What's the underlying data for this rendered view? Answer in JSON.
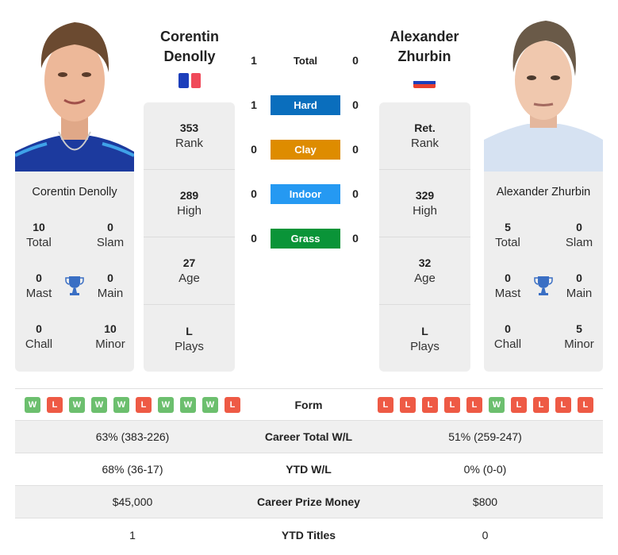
{
  "player1": {
    "name": "Corentin Denolly",
    "name_line1": "Corentin",
    "name_line2": "Denolly",
    "country_flag": "France",
    "flag_colors": [
      "#1d3fbb",
      "#ffffff",
      "#f04a5a"
    ],
    "stats": [
      {
        "value": "353",
        "label": "Rank"
      },
      {
        "value": "289",
        "label": "High"
      },
      {
        "value": "27",
        "label": "Age"
      },
      {
        "value": "L",
        "label": "Plays"
      }
    ],
    "titles": {
      "total": {
        "value": "10",
        "label": "Total"
      },
      "slam": {
        "value": "0",
        "label": "Slam"
      },
      "mast": {
        "value": "0",
        "label": "Mast"
      },
      "main": {
        "value": "0",
        "label": "Main"
      },
      "chall": {
        "value": "0",
        "label": "Chall"
      },
      "minor": {
        "value": "10",
        "label": "Minor"
      }
    },
    "form": [
      "W",
      "L",
      "W",
      "W",
      "W",
      "L",
      "W",
      "W",
      "W",
      "L"
    ]
  },
  "player2": {
    "name": "Alexander Zhurbin",
    "name_line1": "Alexander",
    "name_line2": "Zhurbin",
    "country_flag": "Russia",
    "flag_colors": [
      "#ffffff",
      "#1c3fbb",
      "#e8402e"
    ],
    "stats": [
      {
        "value": "Ret.",
        "label": "Rank"
      },
      {
        "value": "329",
        "label": "High"
      },
      {
        "value": "32",
        "label": "Age"
      },
      {
        "value": "L",
        "label": "Plays"
      }
    ],
    "titles": {
      "total": {
        "value": "5",
        "label": "Total"
      },
      "slam": {
        "value": "0",
        "label": "Slam"
      },
      "mast": {
        "value": "0",
        "label": "Mast"
      },
      "main": {
        "value": "0",
        "label": "Main"
      },
      "chall": {
        "value": "0",
        "label": "Chall"
      },
      "minor": {
        "value": "5",
        "label": "Minor"
      }
    },
    "form": [
      "L",
      "L",
      "L",
      "L",
      "L",
      "W",
      "L",
      "L",
      "L",
      "L"
    ]
  },
  "h2h": [
    {
      "surface": "Total",
      "p1": "1",
      "p2": "0",
      "color": "transparent"
    },
    {
      "surface": "Hard",
      "p1": "1",
      "p2": "0",
      "color": "#0a6ebd"
    },
    {
      "surface": "Clay",
      "p1": "0",
      "p2": "0",
      "color": "#de8c00"
    },
    {
      "surface": "Indoor",
      "p1": "0",
      "p2": "0",
      "color": "#2599f2"
    },
    {
      "surface": "Grass",
      "p1": "0",
      "p2": "0",
      "color": "#0a9438"
    }
  ],
  "form_label": "Form",
  "comparison": [
    {
      "label": "Career Total W/L",
      "p1": "63% (383-226)",
      "p2": "51% (259-247)"
    },
    {
      "label": "YTD W/L",
      "p1": "68% (36-17)",
      "p2": "0% (0-0)"
    },
    {
      "label": "Career Prize Money",
      "p1": "$45,000",
      "p2": "$800"
    },
    {
      "label": "YTD Titles",
      "p1": "1",
      "p2": "0"
    }
  ],
  "icons": {
    "trophy": "trophy-icon",
    "trophy_color": "#3a6fc4"
  }
}
